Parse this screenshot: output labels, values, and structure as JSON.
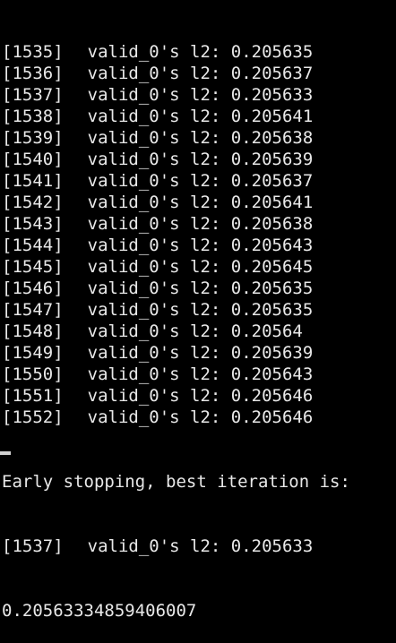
{
  "terminal": {
    "log_lines": [
      {
        "iter": "[1535]",
        "metric": "valid_0's l2: 0.205635"
      },
      {
        "iter": "[1536]",
        "metric": "valid_0's l2: 0.205637"
      },
      {
        "iter": "[1537]",
        "metric": "valid_0's l2: 0.205633"
      },
      {
        "iter": "[1538]",
        "metric": "valid_0's l2: 0.205641"
      },
      {
        "iter": "[1539]",
        "metric": "valid_0's l2: 0.205638"
      },
      {
        "iter": "[1540]",
        "metric": "valid_0's l2: 0.205639"
      },
      {
        "iter": "[1541]",
        "metric": "valid_0's l2: 0.205637"
      },
      {
        "iter": "[1542]",
        "metric": "valid_0's l2: 0.205641"
      },
      {
        "iter": "[1543]",
        "metric": "valid_0's l2: 0.205638"
      },
      {
        "iter": "[1544]",
        "metric": "valid_0's l2: 0.205643"
      },
      {
        "iter": "[1545]",
        "metric": "valid_0's l2: 0.205645"
      },
      {
        "iter": "[1546]",
        "metric": "valid_0's l2: 0.205635"
      },
      {
        "iter": "[1547]",
        "metric": "valid_0's l2: 0.205635"
      },
      {
        "iter": "[1548]",
        "metric": "valid_0's l2: 0.20564"
      },
      {
        "iter": "[1549]",
        "metric": "valid_0's l2: 0.205639"
      },
      {
        "iter": "[1550]",
        "metric": "valid_0's l2: 0.205643"
      },
      {
        "iter": "[1551]",
        "metric": "valid_0's l2: 0.205646"
      },
      {
        "iter": "[1552]",
        "metric": "valid_0's l2: 0.205646"
      }
    ],
    "early_stopping_message": "Early stopping, best iteration is:",
    "best_line": {
      "iter": "[1537]",
      "metric": "valid_0's l2: 0.205633"
    },
    "final_score": "0.20563334859406007"
  },
  "colors": {
    "background": "#000000",
    "text": "#e8e8e8"
  }
}
